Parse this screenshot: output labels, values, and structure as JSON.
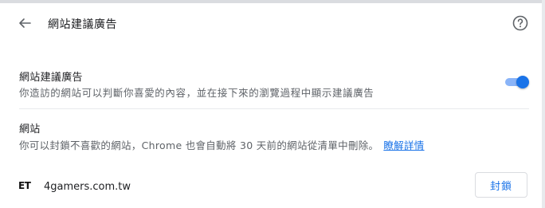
{
  "header": {
    "title": "網站建議廣告",
    "back_icon": "arrow-back-icon",
    "help_icon": "help-icon"
  },
  "toggle_row": {
    "title": "網站建議廣告",
    "description": "你造訪的網站可以判斷你喜愛的內容，並在接下來的瀏覽過程中顯示建議廣告",
    "enabled": true
  },
  "sites_section": {
    "title": "網站",
    "description": "你可以封鎖不喜歡的網站，Chrome 也會自動將 30 天前的網站從清單中刪除。",
    "learn_more": "瞭解詳情"
  },
  "sites": [
    {
      "favicon_text": "ET",
      "name": "4gamers.com.tw",
      "block_label": "封鎖"
    }
  ],
  "colors": {
    "accent": "#1a73e8",
    "toggle_track": "#8ab4f8",
    "secondary_text": "#5f6368",
    "divider": "#e8eaed"
  }
}
